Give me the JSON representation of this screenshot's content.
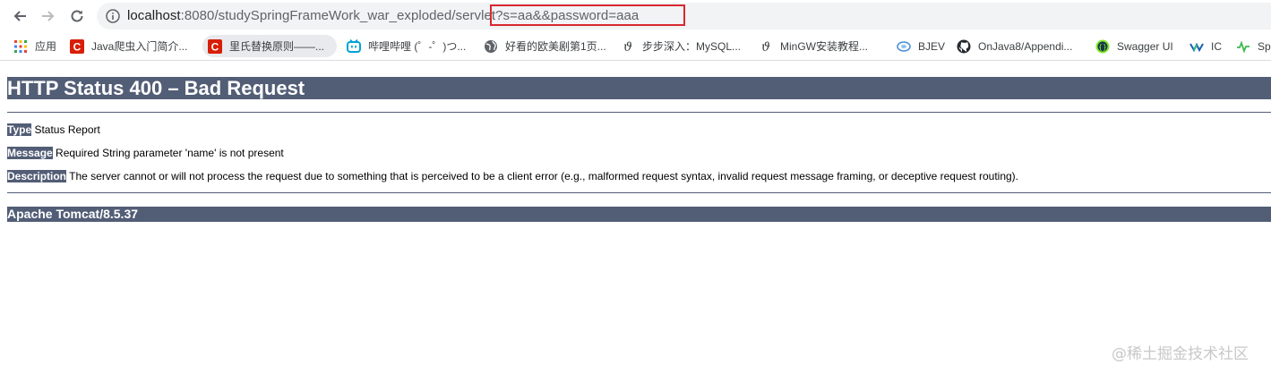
{
  "browser": {
    "url_host": "localhost",
    "url_path": ":8080/studySpringFrameWork_war_exploded/servlet",
    "url_query": "?s=aa&&password=aaa",
    "bookmarks": [
      {
        "label": "应用",
        "icon": "apps-grid-icon"
      },
      {
        "label": "Java爬虫入门简介...",
        "icon": "csdn-icon"
      },
      {
        "label": "里氏替换原则——...",
        "icon": "csdn-icon"
      },
      {
        "label": "哔哩哔哩 (゜-゜)つ...",
        "icon": "bilibili-icon"
      },
      {
        "label": "好看的欧美剧第1页...",
        "icon": "globe-icon"
      },
      {
        "label": "步步深入：MySQL...",
        "icon": "jianshu-icon"
      },
      {
        "label": "MinGW安装教程...",
        "icon": "jianshu-icon"
      },
      {
        "label": "BJEV",
        "icon": "bjev-icon"
      },
      {
        "label": "OnJava8/Appendi...",
        "icon": "github-icon"
      },
      {
        "label": "Swagger UI",
        "icon": "swagger-icon"
      },
      {
        "label": "IC",
        "icon": "ic-icon"
      },
      {
        "label": "Sp",
        "icon": "spring-icon"
      }
    ]
  },
  "error": {
    "title": "HTTP Status 400 – Bad Request",
    "type_label": "Type",
    "type_value": " Status Report",
    "message_label": "Message",
    "message_value": " Required String parameter 'name' is not present",
    "description_label": "Description",
    "description_value": " The server cannot or will not process the request due to something that is perceived to be a client error (e.g., malformed request syntax, invalid request message framing, or deceptive request routing).",
    "server": "Apache Tomcat/8.5.37"
  },
  "watermark": "@稀土掘金技术社区",
  "colors": {
    "tomcat_header": "#525d76",
    "highlight_box": "#d9282f"
  }
}
